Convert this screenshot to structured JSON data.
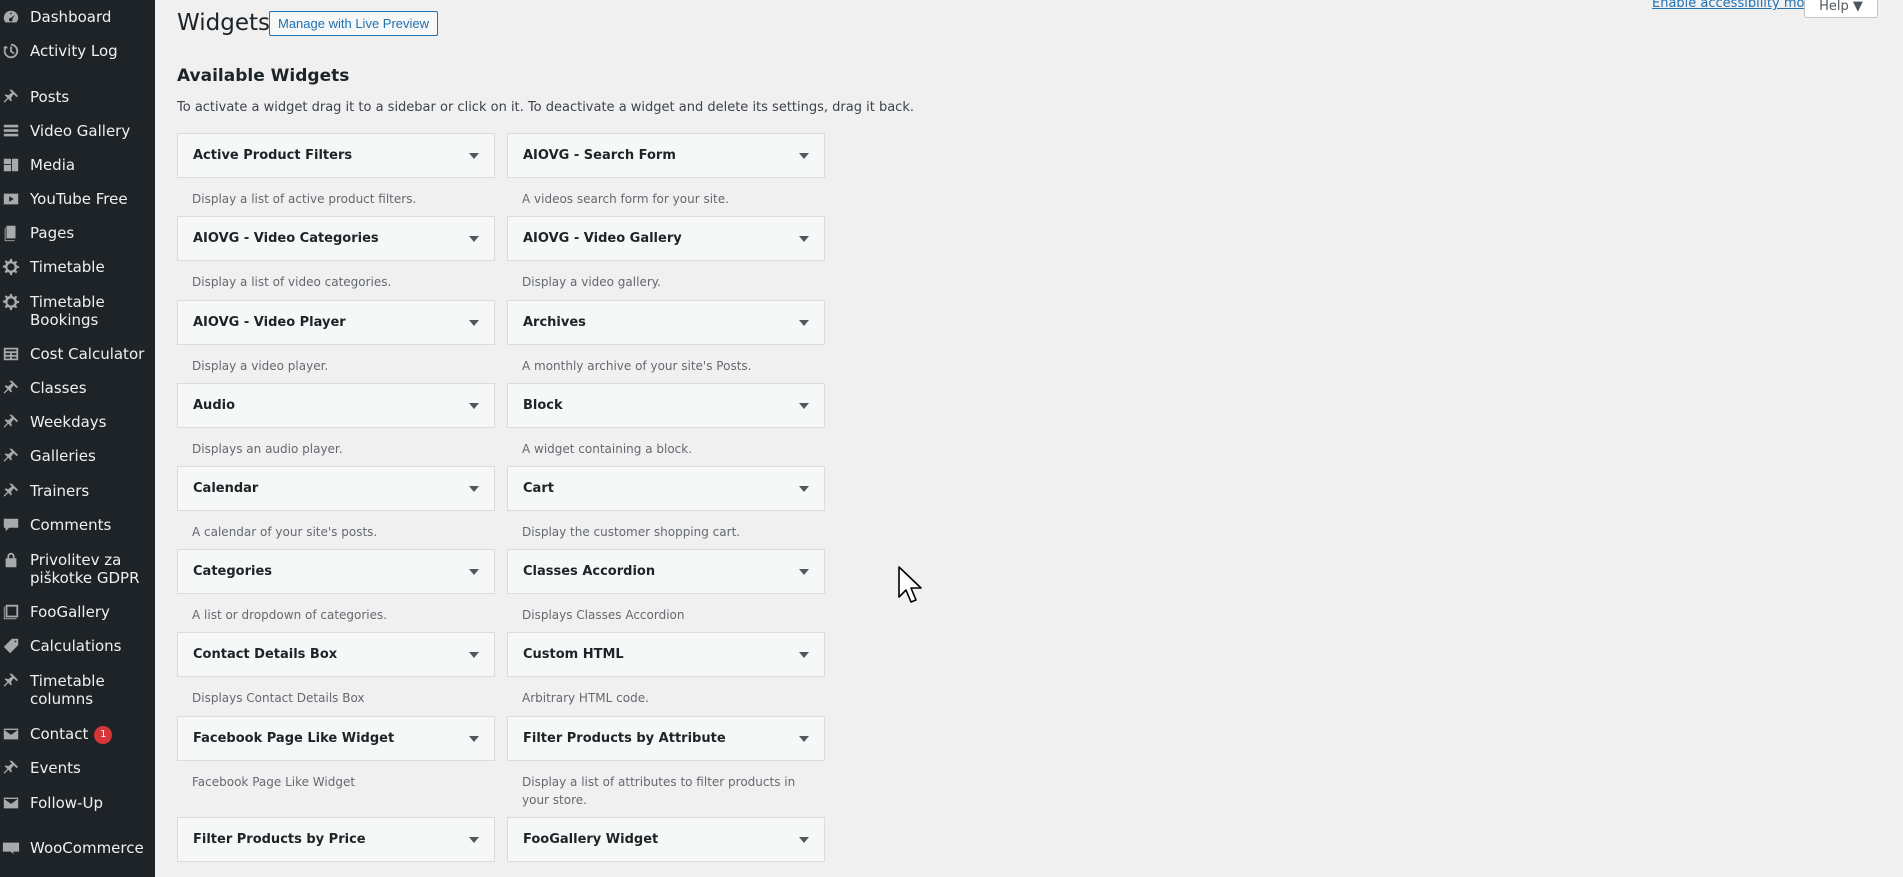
{
  "sidebar": {
    "items": [
      {
        "label": "Dashboard",
        "icon": "dashboard-icon"
      },
      {
        "label": "Activity Log",
        "icon": "history-icon"
      },
      {
        "label": "Posts",
        "icon": "pin-icon"
      },
      {
        "label": "Video Gallery",
        "icon": "list-icon"
      },
      {
        "label": "Media",
        "icon": "media-icon"
      },
      {
        "label": "YouTube Free",
        "icon": "video-icon"
      },
      {
        "label": "Pages",
        "icon": "pages-icon"
      },
      {
        "label": "Timetable",
        "icon": "gear-icon"
      },
      {
        "label": "Timetable Bookings",
        "icon": "gear-icon"
      },
      {
        "label": "Cost Calculator",
        "icon": "table-icon"
      },
      {
        "label": "Classes",
        "icon": "pin-icon"
      },
      {
        "label": "Weekdays",
        "icon": "pin-icon"
      },
      {
        "label": "Galleries",
        "icon": "pin-icon"
      },
      {
        "label": "Trainers",
        "icon": "pin-icon"
      },
      {
        "label": "Comments",
        "icon": "comment-icon"
      },
      {
        "label": "Privolitev za piškotke GDPR",
        "icon": "lock-icon"
      },
      {
        "label": "FooGallery",
        "icon": "gallery-icon"
      },
      {
        "label": "Calculations",
        "icon": "tag-icon"
      },
      {
        "label": "Timetable columns",
        "icon": "pin-icon"
      },
      {
        "label": "Contact",
        "icon": "mail-icon",
        "badge": "1"
      },
      {
        "label": "Events",
        "icon": "pin-icon"
      },
      {
        "label": "Follow-Up",
        "icon": "mail-icon"
      },
      {
        "label": "WooCommerce",
        "icon": "woo-icon"
      }
    ]
  },
  "header": {
    "title": "Widgets",
    "live_preview_label": "Manage with Live Preview",
    "a11y_label": "Enable accessibility mode",
    "help_label": "Help ▼"
  },
  "available": {
    "title": "Available Widgets",
    "description": "To activate a widget drag it to a sidebar or click on it. To deactivate a widget and delete its settings, drag it back.",
    "widgets": [
      {
        "name": "Active Product Filters",
        "desc": "Display a list of active product filters."
      },
      {
        "name": "AIOVG - Search Form",
        "desc": "A videos search form for your site."
      },
      {
        "name": "AIOVG - Video Categories",
        "desc": "Display a list of video categories."
      },
      {
        "name": "AIOVG - Video Gallery",
        "desc": "Display a video gallery."
      },
      {
        "name": "AIOVG - Video Player",
        "desc": "Display a video player."
      },
      {
        "name": "Archives",
        "desc": "A monthly archive of your site's Posts."
      },
      {
        "name": "Audio",
        "desc": "Displays an audio player."
      },
      {
        "name": "Block",
        "desc": "A widget containing a block."
      },
      {
        "name": "Calendar",
        "desc": "A calendar of your site's posts."
      },
      {
        "name": "Cart",
        "desc": "Display the customer shopping cart."
      },
      {
        "name": "Categories",
        "desc": "A list or dropdown of categories."
      },
      {
        "name": "Classes Accordion",
        "desc": "Displays Classes Accordion"
      },
      {
        "name": "Contact Details Box",
        "desc": "Displays Contact Details Box"
      },
      {
        "name": "Custom HTML",
        "desc": "Arbitrary HTML code."
      },
      {
        "name": "Facebook Page Like Widget",
        "desc": "Facebook Page Like Widget"
      },
      {
        "name": "Filter Products by Attribute",
        "desc": "Display a list of attributes to filter products in your store."
      },
      {
        "name": "Filter Products by Price",
        "desc": ""
      },
      {
        "name": "FooGallery Widget",
        "desc": ""
      }
    ]
  }
}
